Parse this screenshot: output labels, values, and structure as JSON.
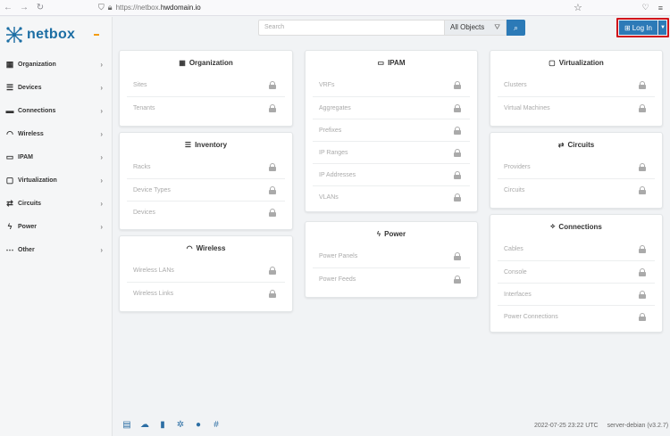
{
  "browser": {
    "url_prefix": "https://netbox.",
    "url_domain": "hwdomain.io",
    "back_icon": "arrow-left-icon",
    "forward_icon": "arrow-right-icon",
    "reload_icon": "reload-icon"
  },
  "brand": {
    "name": "netbox"
  },
  "sidebar": {
    "items": [
      {
        "label": "Organization",
        "icon": "building-icon",
        "glyph": "▦"
      },
      {
        "label": "Devices",
        "icon": "server-icon",
        "glyph": "☰"
      },
      {
        "label": "Connections",
        "icon": "ethernet-icon",
        "glyph": "▬"
      },
      {
        "label": "Wireless",
        "icon": "wifi-icon",
        "glyph": "◠"
      },
      {
        "label": "IPAM",
        "icon": "counter-icon",
        "glyph": "▭"
      },
      {
        "label": "Virtualization",
        "icon": "monitor-icon",
        "glyph": "▢"
      },
      {
        "label": "Circuits",
        "icon": "transit-icon",
        "glyph": "⇄"
      },
      {
        "label": "Power",
        "icon": "flash-icon",
        "glyph": "ϟ"
      },
      {
        "label": "Other",
        "icon": "dots-icon",
        "glyph": "⋯"
      }
    ]
  },
  "search": {
    "placeholder": "Search",
    "object_select": "All Objects"
  },
  "login": {
    "label": "Log In"
  },
  "panels": {
    "organization": {
      "title": "Organization",
      "items": [
        "Sites",
        "Tenants"
      ]
    },
    "inventory": {
      "title": "Inventory",
      "items": [
        "Racks",
        "Device Types",
        "Devices"
      ]
    },
    "wireless": {
      "title": "Wireless",
      "items": [
        "Wireless LANs",
        "Wireless Links"
      ]
    },
    "ipam": {
      "title": "IPAM",
      "items": [
        "VRFs",
        "Aggregates",
        "Prefixes",
        "IP Ranges",
        "IP Addresses",
        "VLANs"
      ]
    },
    "power": {
      "title": "Power",
      "items": [
        "Power Panels",
        "Power Feeds"
      ]
    },
    "virtualization": {
      "title": "Virtualization",
      "items": [
        "Clusters",
        "Virtual Machines"
      ]
    },
    "circuits": {
      "title": "Circuits",
      "items": [
        "Providers",
        "Circuits"
      ]
    },
    "connections": {
      "title": "Connections",
      "items": [
        "Cables",
        "Console",
        "Interfaces",
        "Power Connections"
      ]
    }
  },
  "footer": {
    "timestamp": "2022-07-25 23:22 UTC",
    "server": "server-debian (v3.2.7)"
  },
  "colors": {
    "accent": "#2c7ab7",
    "brand": "#1c6ea4",
    "highlight": "#d0141b"
  }
}
